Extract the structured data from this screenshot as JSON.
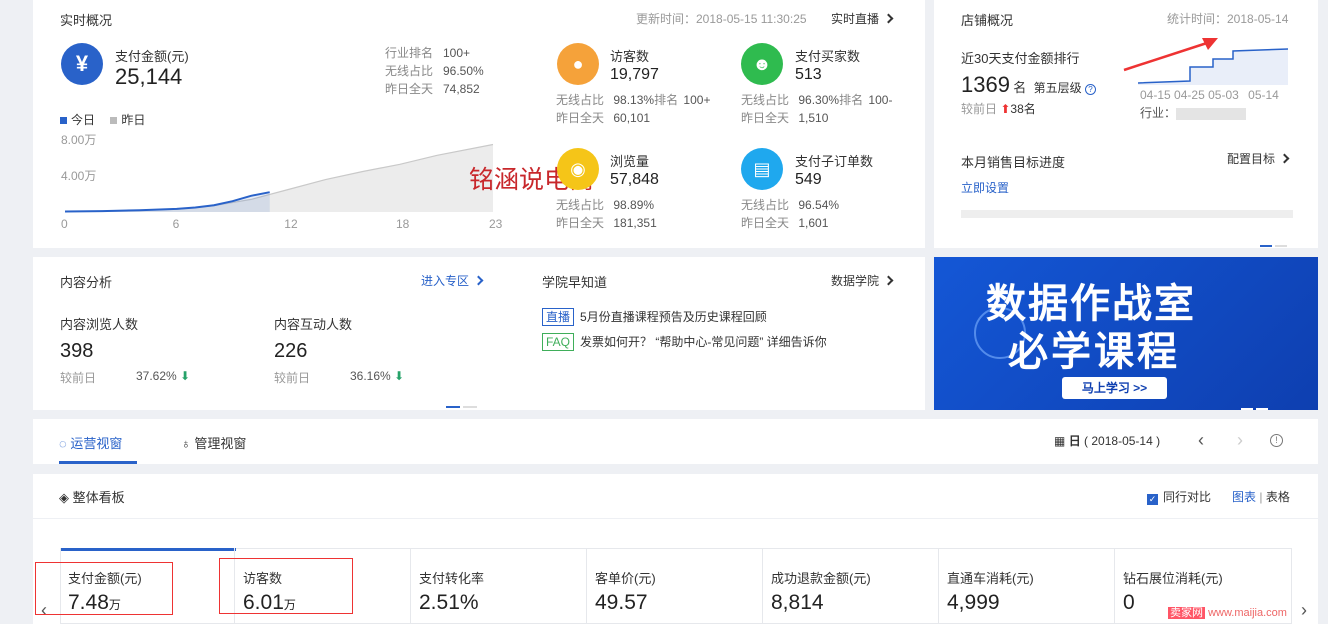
{
  "realtime": {
    "title": "实时概况",
    "update_time": "更新时间：2018-05-15 11:30:25",
    "live_link": "实时直播",
    "pay": {
      "label": "支付金额(元)",
      "value": "25,144",
      "rank_label": "行业排名",
      "rank": "100+",
      "wireless_label": "无线占比",
      "wireless": "96.50%",
      "yesterday_label": "昨日全天",
      "yesterday": "74,852"
    },
    "legend_today": "今日",
    "legend_yesterday": "昨日",
    "chart_data": {
      "type": "area",
      "x_ticks": [
        "0",
        "6",
        "12",
        "18",
        "23"
      ],
      "y_ticks": [
        "8.00万",
        "4.00万"
      ],
      "series": [
        {
          "name": "今日",
          "x": [
            0,
            2,
            4,
            6,
            7,
            8,
            9,
            10,
            11
          ],
          "values": [
            0.05,
            0.1,
            0.2,
            0.35,
            0.5,
            0.75,
            1.2,
            1.8,
            2.2
          ]
        },
        {
          "name": "昨日",
          "x": [
            0,
            2,
            4,
            6,
            8,
            10,
            12,
            14,
            16,
            18,
            20,
            23
          ],
          "values": [
            0.05,
            0.1,
            0.2,
            0.3,
            0.7,
            1.4,
            2.5,
            3.6,
            4.5,
            5.3,
            6.3,
            7.5
          ]
        }
      ]
    },
    "visitors": {
      "label": "访客数",
      "value": "19,797",
      "l1": "无线占比",
      "v1": "98.13%",
      "l2": "排名",
      "v2": "100+",
      "l3": "昨日全天",
      "v3": "60,101"
    },
    "buyers": {
      "label": "支付买家数",
      "value": "513",
      "l1": "无线占比",
      "v1": "96.30%",
      "l2": "排名",
      "v2": "100-",
      "l3": "昨日全天",
      "v3": "1,510"
    },
    "views": {
      "label": "浏览量",
      "value": "57,848",
      "l1": "无线占比",
      "v1": "98.89%",
      "l3": "昨日全天",
      "v3": "181,351"
    },
    "suborders": {
      "label": "支付子订单数",
      "value": "549",
      "l1": "无线占比",
      "v1": "96.54%",
      "l3": "昨日全天",
      "v3": "1,601"
    },
    "watermark": "铭涵说电商"
  },
  "shop": {
    "title": "店铺概况",
    "stat_time": "统计时间：2018-05-14",
    "rank_title": "近30天支付金额排行",
    "rank_value": "1369",
    "rank_unit": "名",
    "tier": "第五层级",
    "compare_label": "较前日",
    "compare_value": "38名",
    "dates": [
      "04-15",
      "04-25",
      "05-03",
      "05-14"
    ],
    "industry_label": "行业：",
    "target_title": "本月销售目标进度",
    "config_link": "配置目标",
    "set_now": "立即设置"
  },
  "content": {
    "title": "内容分析",
    "enter_link": "进入专区",
    "view_label": "内容浏览人数",
    "view_value": "398",
    "view_cmp": "较前日",
    "view_pct": "37.62%",
    "inter_label": "内容互动人数",
    "inter_value": "226",
    "inter_cmp": "较前日",
    "inter_pct": "36.16%"
  },
  "academy": {
    "title": "学院早知道",
    "link": "数据学院",
    "items": [
      {
        "tag": "直播",
        "text": "5月份直播课程预告及历史课程回顾"
      },
      {
        "tag": "FAQ",
        "text": "发票如何开？ “帮助中心-常见问题” 详细告诉你"
      }
    ]
  },
  "banner": {
    "line1": "数据作战室",
    "line2": "必学课程",
    "button": "马上学习 >>"
  },
  "tabs": {
    "ops": "运营视窗",
    "mgmt": "管理视窗",
    "date_label": "日",
    "date": "( 2018-05-14 )"
  },
  "board": {
    "title": "整体看板",
    "peer": "同行对比",
    "chart_view": "图表",
    "sep": "|",
    "table_view": "表格",
    "metrics": [
      {
        "label": "支付金额(元)",
        "value": "7.48",
        "unit": "万"
      },
      {
        "label": "访客数",
        "value": "6.01",
        "unit": "万"
      },
      {
        "label": "支付转化率",
        "value": "2.51%",
        "unit": ""
      },
      {
        "label": "客单价(元)",
        "value": "49.57",
        "unit": ""
      },
      {
        "label": "成功退款金额(元)",
        "value": "8,814",
        "unit": ""
      },
      {
        "label": "直通车消耗(元)",
        "value": "4,999",
        "unit": ""
      },
      {
        "label": "钻石展位消耗(元)",
        "value": "0",
        "unit": ""
      }
    ]
  },
  "footer_watermark": {
    "brand": "卖家网",
    "url": "www.maijia.com"
  },
  "colors": {
    "accent": "#2962c9",
    "orange": "#f5a23a",
    "green": "#2fbb4f",
    "yellow": "#f5c518",
    "cyan": "#1fa8ee",
    "up": "#e33",
    "down": "#26a269"
  }
}
